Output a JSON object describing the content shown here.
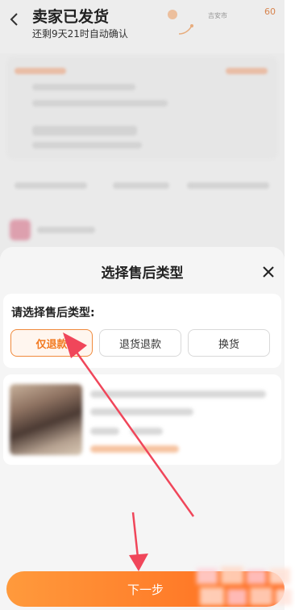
{
  "order": {
    "status_title": "卖家已发货",
    "status_subtitle": "还剩9天21时自动确认",
    "map_city": "吉安市",
    "map_number": "60"
  },
  "sheet": {
    "title": "选择售后类型",
    "type_label": "请选择售后类型:",
    "options": [
      {
        "label": "仅退款",
        "selected": true
      },
      {
        "label": "退货退款",
        "selected": false
      },
      {
        "label": "换货",
        "selected": false
      }
    ],
    "next_label": "下一步"
  },
  "colors": {
    "accent": "#f27a22",
    "annotation_arrow": "#f0465a"
  },
  "icons": [
    "back-arrow-icon",
    "close-icon",
    "location-pin-icon"
  ]
}
